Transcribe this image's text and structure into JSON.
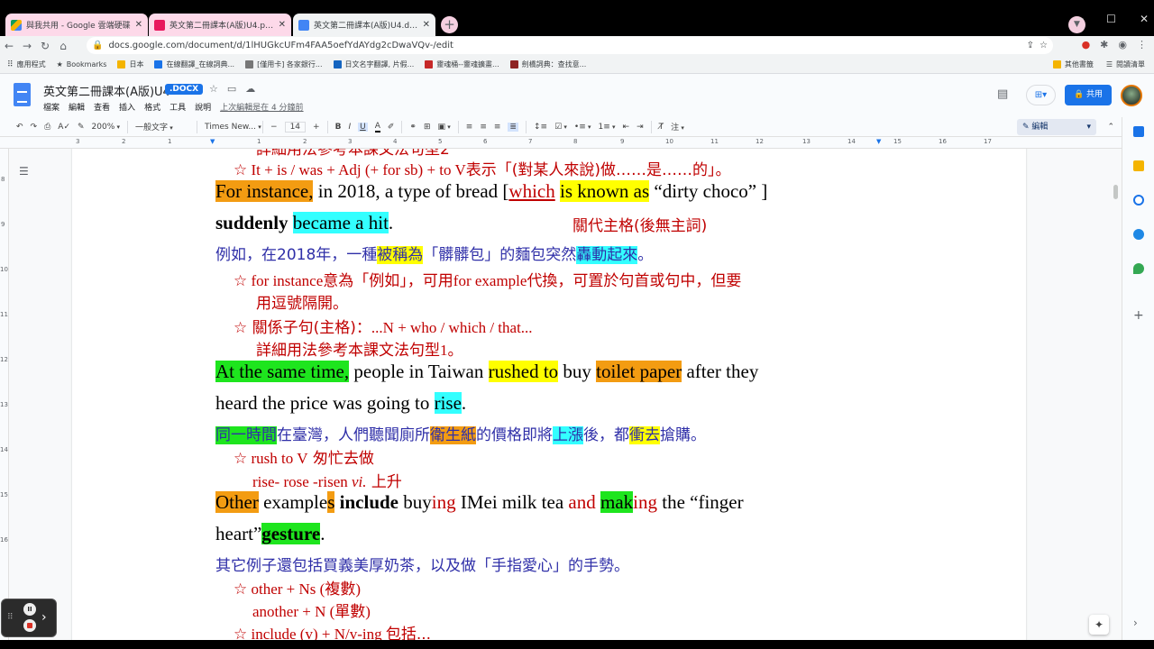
{
  "tabs": [
    {
      "title": "與我共用 - Google 雲端硬碟",
      "icon": "google-drive-icon",
      "active": false
    },
    {
      "title": "英文第二冊課本(A版)U4.pdf - L...",
      "icon": "pdf-icon",
      "active": false
    },
    {
      "title": "英文第二冊課本(A版)U4.docx -...",
      "icon": "google-docs-icon",
      "active": true
    }
  ],
  "browser": {
    "url": "docs.google.com/document/d/1lHUGkcUFm4FAA5oefYdAYdg2cDwaVQv-/edit"
  },
  "bookmarks": [
    "應用程式",
    "Bookmarks",
    "日本",
    "在線翻譯_在線詞典...",
    "[僅用卡] 各家銀行...",
    "日文名字翻譯, 片假...",
    "靈魂桶--靈魂擴畫...",
    "劍橋詞典：查找意..."
  ],
  "bookmarks_right": [
    "其他書籤",
    "閱讀清單"
  ],
  "doc": {
    "title": "英文第二冊課本(A版)U4",
    "badge": ".DOCX",
    "menu": [
      "檔案",
      "編輯",
      "查看",
      "插入",
      "格式",
      "工具",
      "說明"
    ],
    "last_edit": "上次編輯是在 4 分鐘前",
    "share": "共用"
  },
  "format": {
    "zoom": "200%",
    "style": "一般文字",
    "font": "Times New...",
    "size": "14",
    "mode": "編輯"
  },
  "ruler": [
    "3",
    "2",
    "1",
    "1",
    "2",
    "3",
    "4",
    "5",
    "6",
    "7",
    "8",
    "9",
    "10",
    "11",
    "12",
    "13",
    "14",
    "15",
    "16",
    "17"
  ],
  "vruler": [
    "8",
    "9",
    "10",
    "11",
    "12",
    "13",
    "14",
    "15",
    "16"
  ],
  "content": {
    "cut_top": "詳細用法參考本課文法句型2",
    "l1": {
      "star": "☆",
      "a": " It + is / was + Adj (+ for sb) + to V",
      "b": "表示「(對某人來說)做……是……的」。"
    },
    "l2": {
      "a": "For instance,",
      "b": " in 2018, a type of bread [",
      "c": "which",
      "d": " ",
      "e": "is known as",
      "f": " “dirty choco” ]"
    },
    "l3": {
      "a": "suddenly",
      "b": " ",
      "c": "became a hit",
      "d": ".",
      "e": "關代主格(後無主詞)"
    },
    "l4": {
      "a": "例如，在2018年，一種",
      "b": "被稱為",
      "c": "「髒髒包」的麵包突然",
      "d": "轟動起來",
      "e": "。"
    },
    "l5": {
      "star": "☆",
      "a": " for instance",
      "b": "意為「例如」，可用",
      "c": "for example",
      "d": "代換，可置於句首或句中，但要"
    },
    "l6": "用逗號隔開。",
    "l7": {
      "star": "☆",
      "a": " 關係子句(主格)：",
      "b": "...N + who / which / that..."
    },
    "l8": {
      "a": "詳細用法參考本課文法句型",
      "b": "1",
      "c": "。"
    },
    "l9": {
      "a": "At the same time,",
      "b": " people in Taiwan ",
      "c": "rushed to",
      "d": " buy  ",
      "e": " toilet paper",
      "f": " after they"
    },
    "l10": {
      "a": "heard the price was going to ",
      "b": "rise",
      "c": "."
    },
    "l11": {
      "a": "同一時間",
      "b": "在臺灣，人們聽聞廁所",
      "c": "衛生紙",
      "d": "的價格即將",
      "e": "上漲",
      "f": "後，都",
      "g": "衝去",
      "h": "搶購。"
    },
    "l12": {
      "star": "☆",
      "a": " rush to V",
      "b": "    匆忙去做"
    },
    "l13": {
      "a": "rise- rose -risen ",
      "b": "vi.",
      "c": " 上升"
    },
    "l14": {
      "a": "Other",
      "b": " example",
      "c": "s",
      "d": " ",
      "e": "include",
      "f": " buy",
      "g": "ing",
      "h": " IMei  milk  tea  ",
      "i": "and",
      "j": " ",
      "k": "mak",
      "l": "ing",
      "m": "  the  “finger"
    },
    "l15": {
      "a": "heart”",
      "b": "gesture",
      "c": "."
    },
    "l16": "其它例子還包括買義美厚奶茶，以及做「手指愛心」的手勢。",
    "l17": {
      "star": "☆",
      "a": " other + Ns (",
      "b": "複數",
      "c": ")"
    },
    "l18": {
      "a": "another + N (",
      "b": "單數",
      "c": ")"
    },
    "l19": {
      "star": "☆",
      "a": " include (v) + N/v-ing ",
      "b": "包括..."
    }
  }
}
